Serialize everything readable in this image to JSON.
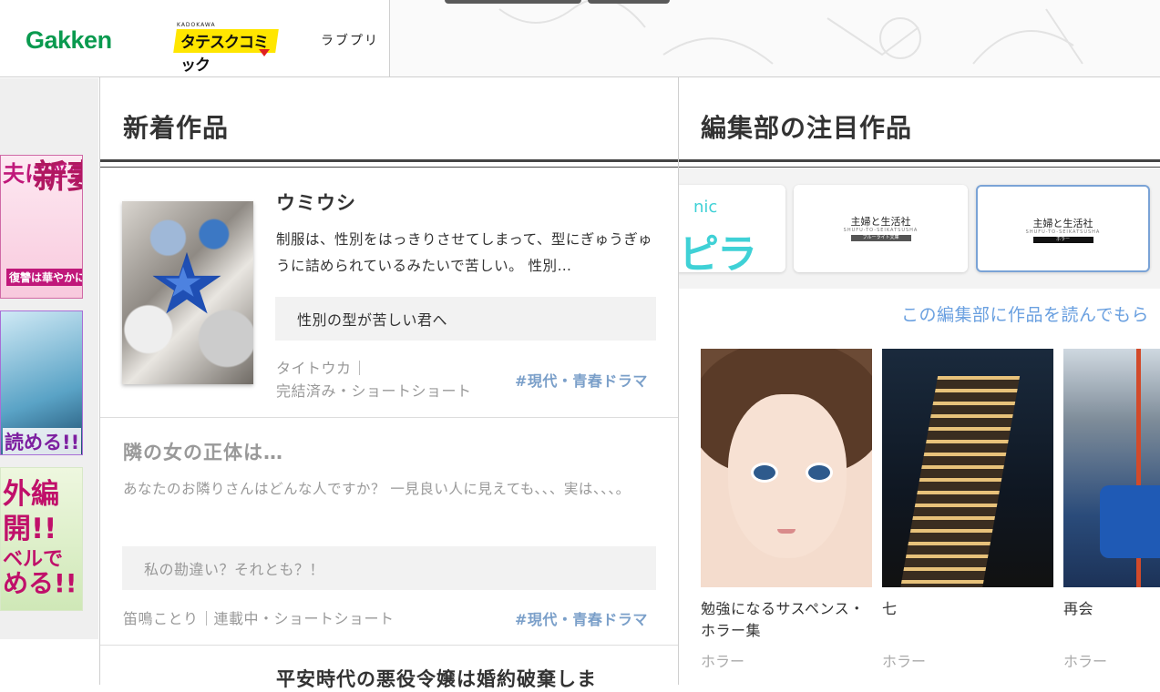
{
  "header": {
    "brands": [
      "Gakken",
      "タテスクコミック",
      "ラブプリ"
    ],
    "kadokawa": "KADOKAWA"
  },
  "ads": [
    {
      "lines": [
        "新妻",
        "夫に浮気",
        "復讐は華やかに"
      ]
    },
    {
      "lines": [
        "読める!!"
      ]
    },
    {
      "lines": [
        "外編",
        "開!!",
        "ベルで",
        "める!!"
      ]
    }
  ],
  "new_works": {
    "heading": "新着作品",
    "items": [
      {
        "title": "ウミウシ",
        "description": "制服は、性別をはっきりさせてしまって、型にぎゅうぎゅうに詰められているみたいで苦しい。 性別…",
        "catchphrase": "性別の型が苦しい君へ",
        "author": "タイトウカ",
        "status": "完結済み・ショートショート",
        "tag": "#現代・青春ドラマ"
      },
      {
        "title": "隣の女の正体は…",
        "description": "あなたのお隣りさんはどんな人ですか？ 一見良い人に見えても、、、実は、、、。",
        "catchphrase": "私の勘違い？それとも？！",
        "author": "笛鳴ことり",
        "status": "連載中・ショートショート",
        "tag": "#現代・青春ドラマ"
      },
      {
        "title": "平安時代の悪役令嬢は婚約破棄しま"
      }
    ]
  },
  "featured": {
    "heading": "編集部の注目作品",
    "publishers": [
      {
        "name": "comic ピラ",
        "sub": ""
      },
      {
        "name": "主婦と生活社",
        "sub": "SHUFU-TO-SEIKATSUSHA",
        "label": "ブルーライト文庫"
      },
      {
        "name": "主婦と生活社",
        "sub": "SHUFU-TO-SEIKATSUSHA",
        "label": "ホラー"
      }
    ],
    "read_link": "この編集部に作品を読んでもら",
    "works": [
      {
        "title": "勉強になるサスペンス・ホラー集",
        "genre": "ホラー"
      },
      {
        "title": "七",
        "genre": "ホラー"
      },
      {
        "title": "再会",
        "genre": "ホラー"
      }
    ]
  }
}
